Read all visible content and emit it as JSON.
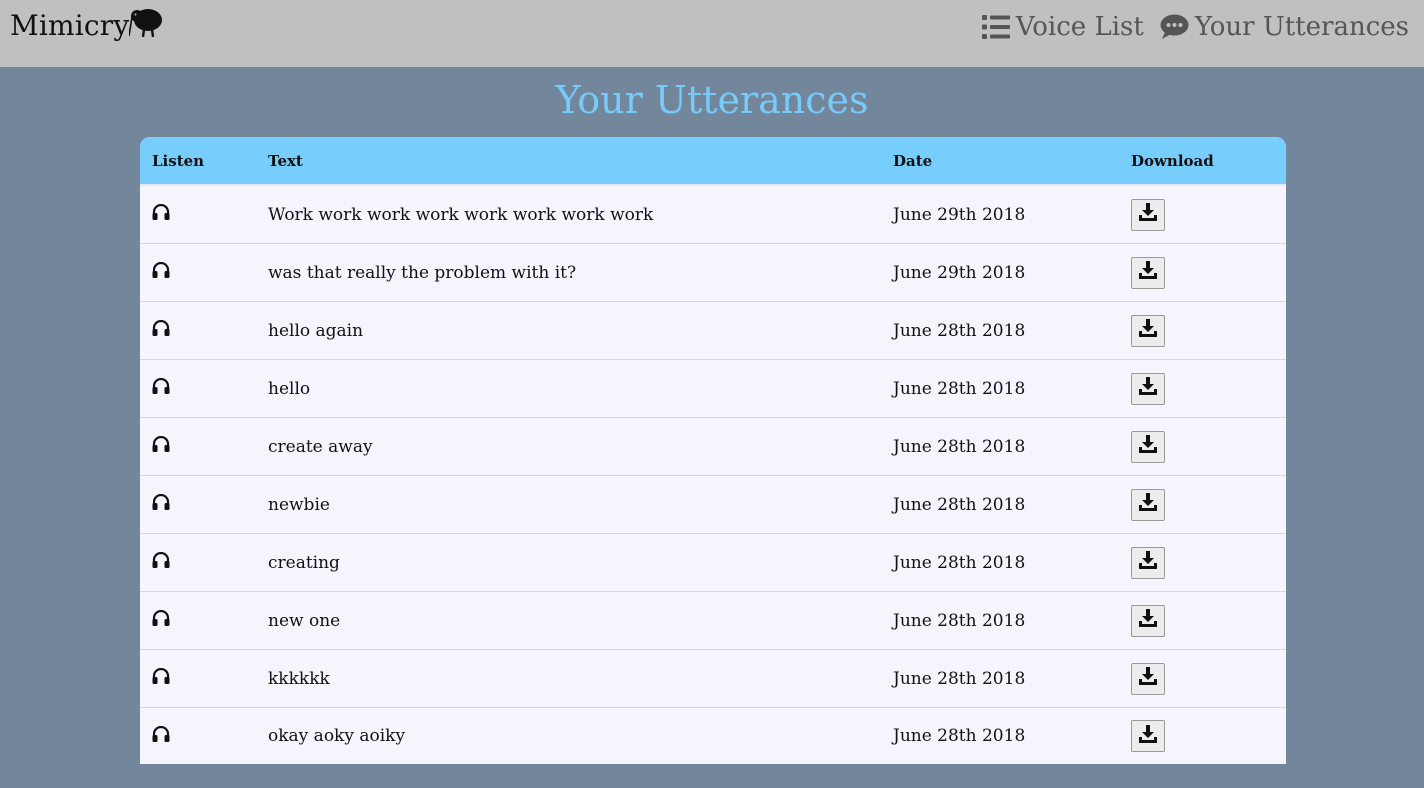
{
  "brand": {
    "name": "Mimicry",
    "logo_icon": "kiwi-bird-icon"
  },
  "nav": [
    {
      "label": "Voice List",
      "icon": "list-icon"
    },
    {
      "label": "Your Utterances",
      "icon": "comment-icon"
    }
  ],
  "page": {
    "title": "Your Utterances"
  },
  "colors": {
    "navbar": "#c0c0c0",
    "background": "#72869c",
    "accent": "#76cbf9",
    "table_header": "#77cdfb"
  },
  "table": {
    "headers": {
      "listen": "Listen",
      "text": "Text",
      "date": "Date",
      "download": "Download"
    },
    "rows": [
      {
        "text": "Work work work work work work work work",
        "date": "June 29th 2018"
      },
      {
        "text": "was that really the problem with it?",
        "date": "June 29th 2018"
      },
      {
        "text": "hello again",
        "date": "June 28th 2018"
      },
      {
        "text": "hello",
        "date": "June 28th 2018"
      },
      {
        "text": "create away",
        "date": "June 28th 2018"
      },
      {
        "text": "newbie",
        "date": "June 28th 2018"
      },
      {
        "text": "creating",
        "date": "June 28th 2018"
      },
      {
        "text": "new one",
        "date": "June 28th 2018"
      },
      {
        "text": "kkkkkk",
        "date": "June 28th 2018"
      },
      {
        "text": "okay aoky aoiky",
        "date": "June 28th 2018"
      }
    ]
  }
}
